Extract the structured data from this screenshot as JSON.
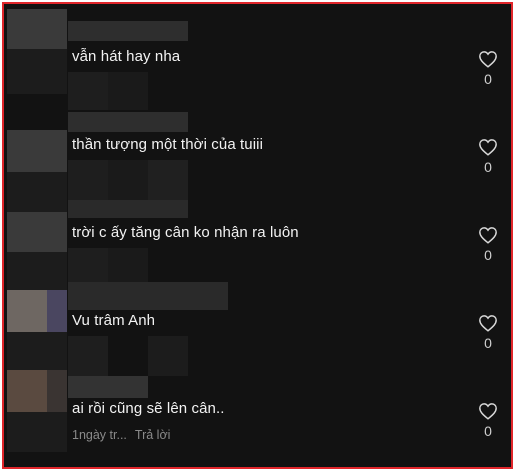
{
  "comments": [
    {
      "text": "vẫn hát hay nha",
      "likes": "0",
      "like_icon": "heart-outline-icon"
    },
    {
      "text": "thần tượng một thời của tuiii",
      "likes": "0",
      "like_icon": "heart-outline-icon"
    },
    {
      "text": "trời c ấy tăng cân ko nhận ra luôn",
      "likes": "0",
      "like_icon": "heart-outline-icon"
    },
    {
      "text": "Vu trâm Anh",
      "likes": "0",
      "like_icon": "heart-outline-icon"
    },
    {
      "text": "ai rồi cũng sẽ lên cân..",
      "likes": "0",
      "like_icon": "heart-outline-icon",
      "time": "1ngày tr...",
      "reply_label": "Trả lời"
    }
  ],
  "colors": {
    "background": "#121212",
    "text": "#f3f3f3",
    "muted": "#8a8a8a",
    "frame": "#e0262b"
  }
}
